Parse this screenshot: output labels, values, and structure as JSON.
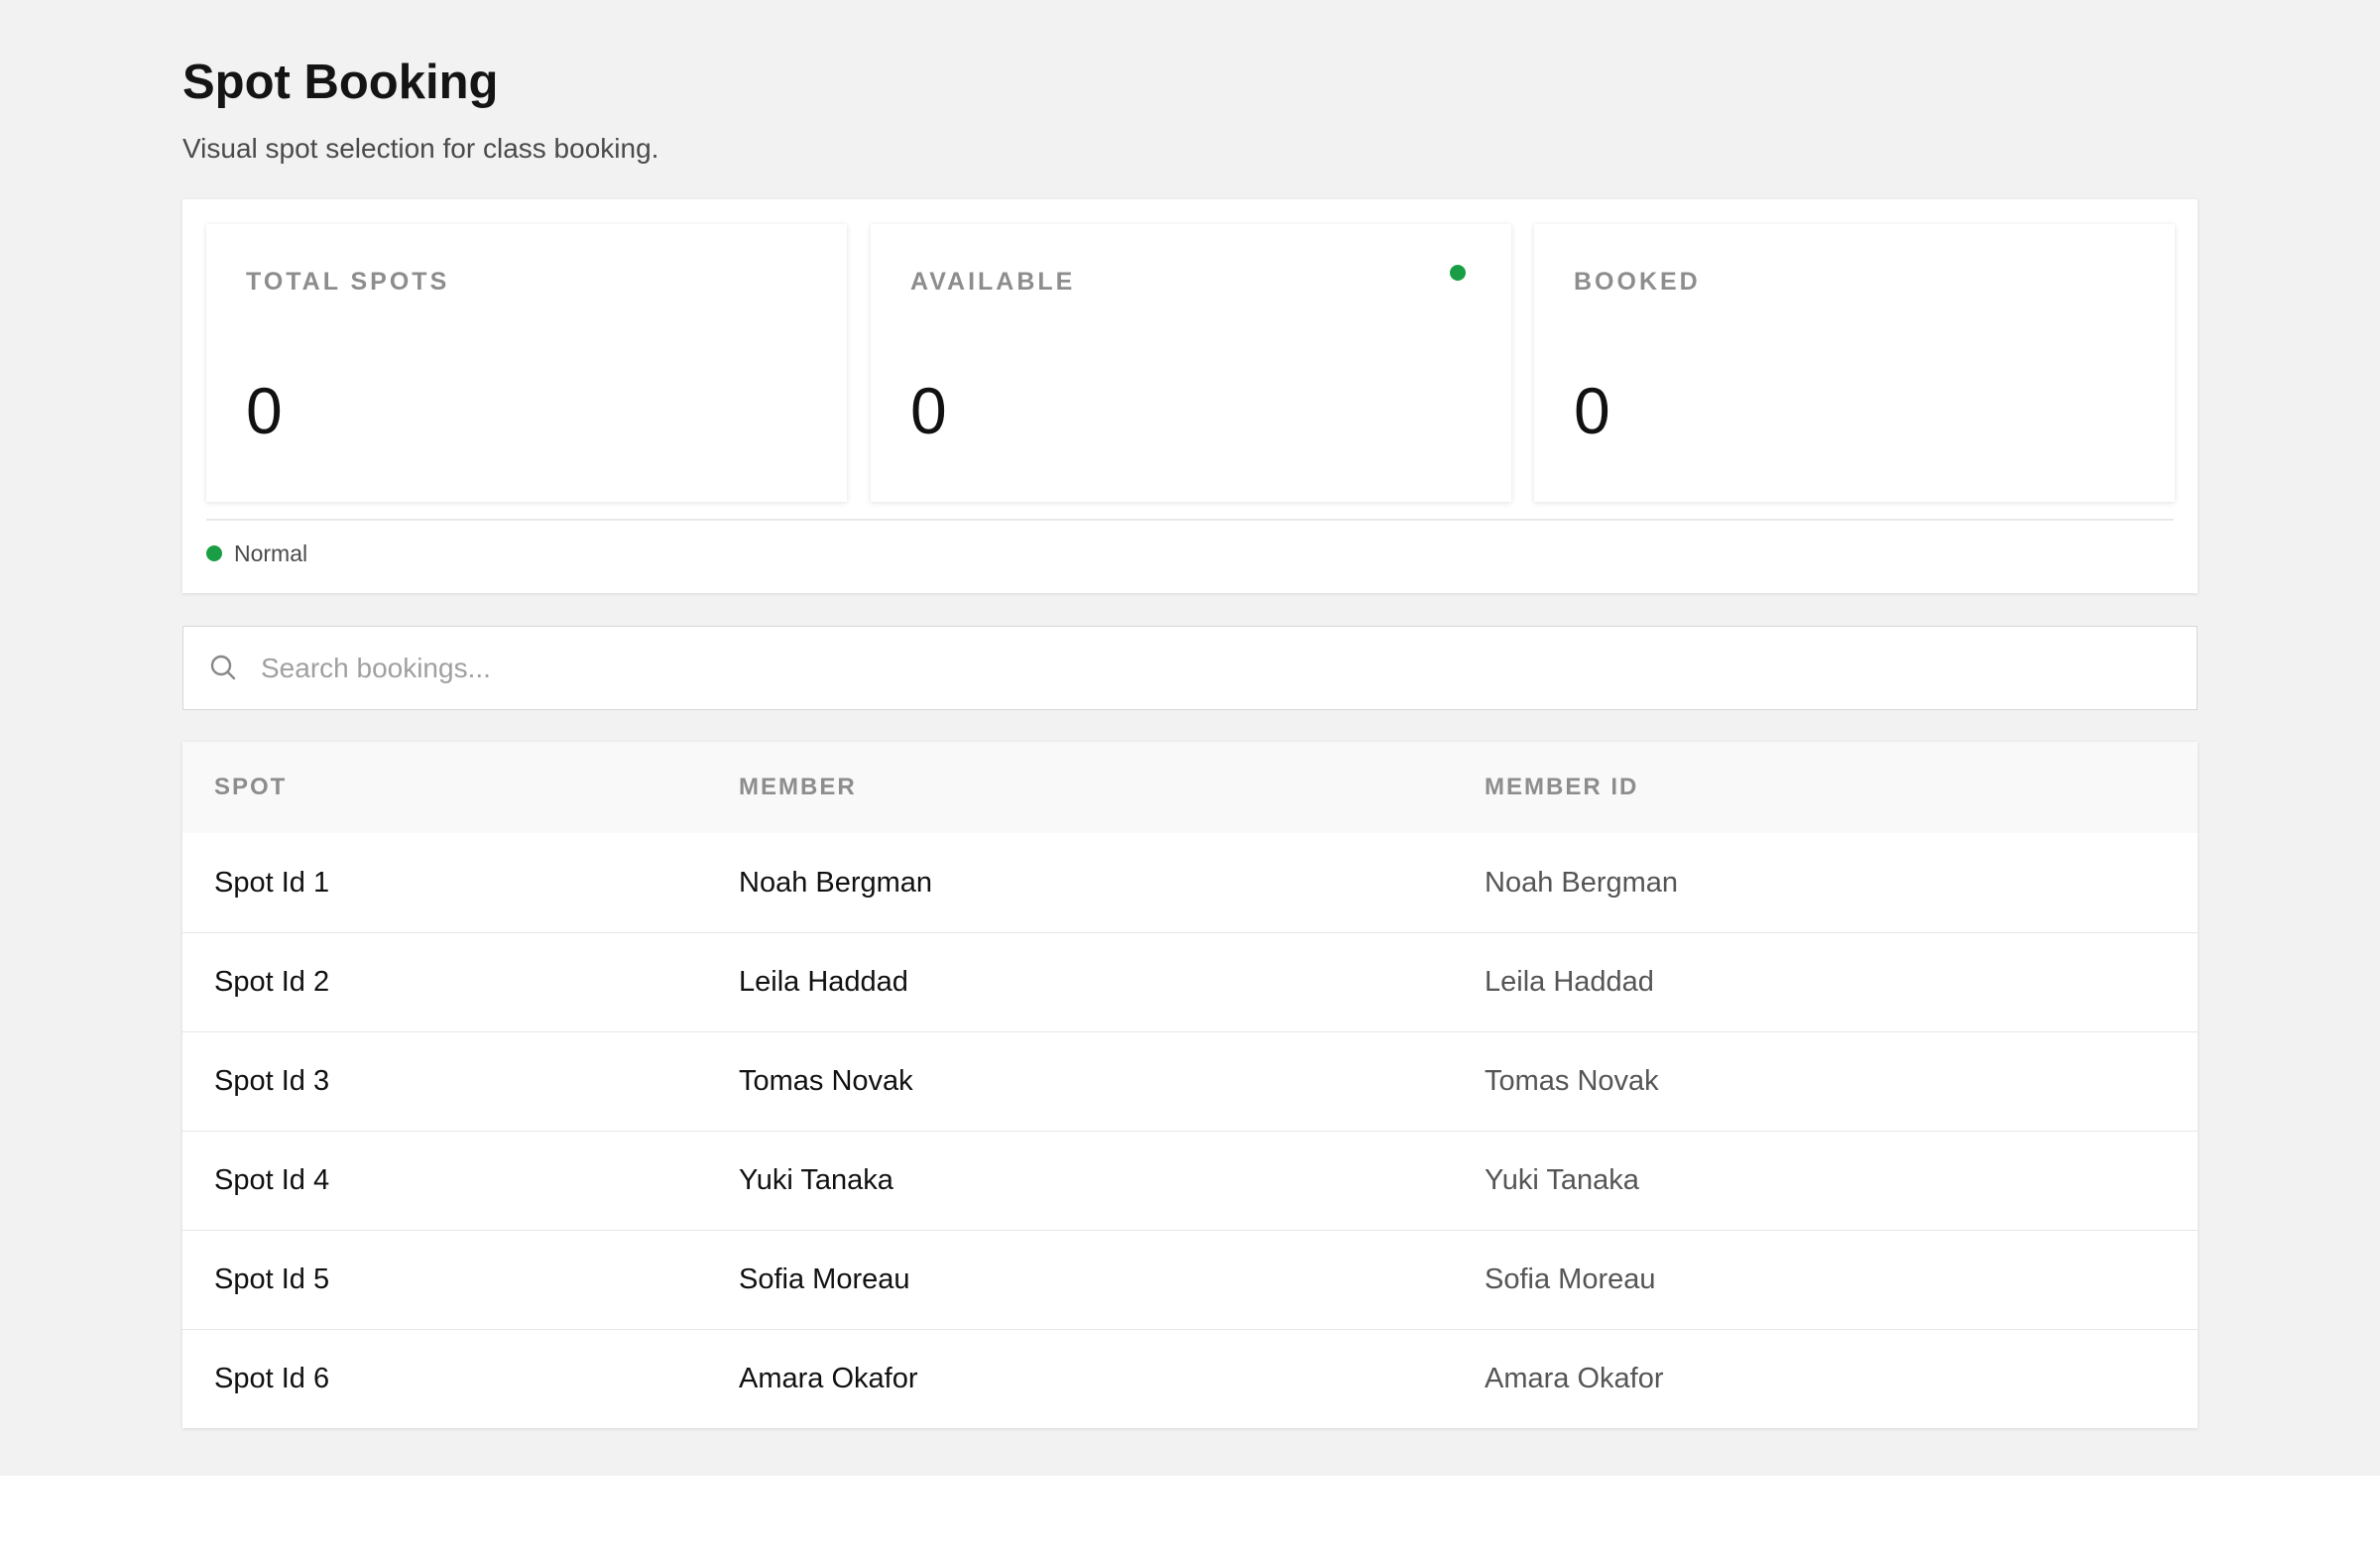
{
  "header": {
    "title": "Spot Booking",
    "subtitle": "Visual spot selection for class booking."
  },
  "stats": {
    "total": {
      "label": "TOTAL SPOTS",
      "value": "0"
    },
    "available": {
      "label": "AVAILABLE",
      "value": "0",
      "indicator_color": "#1a9e45"
    },
    "booked": {
      "label": "BOOKED",
      "value": "0"
    },
    "status": {
      "label": "Normal",
      "color": "#1a9e45"
    }
  },
  "search": {
    "placeholder": "Search bookings...",
    "value": "",
    "icon": "search-icon"
  },
  "table": {
    "columns": [
      "SPOT",
      "MEMBER",
      "MEMBER ID"
    ],
    "rows": [
      {
        "spot": "Spot Id 1",
        "member": "Noah Bergman",
        "member_id": "Noah Bergman"
      },
      {
        "spot": "Spot Id 2",
        "member": "Leila Haddad",
        "member_id": "Leila Haddad"
      },
      {
        "spot": "Spot Id 3",
        "member": "Tomas Novak",
        "member_id": "Tomas Novak"
      },
      {
        "spot": "Spot Id 4",
        "member": "Yuki Tanaka",
        "member_id": "Yuki Tanaka"
      },
      {
        "spot": "Spot Id 5",
        "member": "Sofia Moreau",
        "member_id": "Sofia Moreau"
      },
      {
        "spot": "Spot Id 6",
        "member": "Amara Okafor",
        "member_id": "Amara Okafor"
      }
    ]
  }
}
